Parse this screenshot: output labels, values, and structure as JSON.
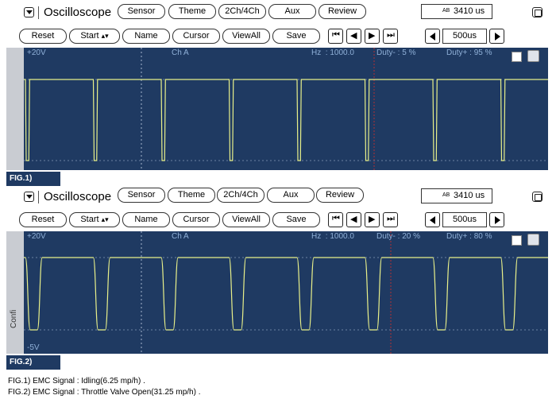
{
  "panels": [
    {
      "title": "Oscilloscope",
      "menu": [
        "Sensor",
        "Theme",
        "2Ch/4Ch",
        "Aux",
        "Review"
      ],
      "time_readout": "3410 us",
      "ab_glyph": "AB",
      "toolbar2": [
        "Reset",
        "Start",
        "Name",
        "Cursor",
        "ViewAll",
        "Save"
      ],
      "timebase": "500us",
      "scale_top": "+20V",
      "scale_bottom": "",
      "channel": "Ch A",
      "hz": "Hz  : 1000.0",
      "duty_minus": "Duty- : 5 %",
      "duty_plus": "Duty+ : 95 %",
      "side_text": "",
      "fig_tag": "FIG.1)",
      "duty_low_fraction": 0.05
    },
    {
      "title": "Oscilloscope",
      "menu": [
        "Sensor",
        "Theme",
        "2Ch/4Ch",
        "Aux",
        "Review"
      ],
      "time_readout": "3410 us",
      "ab_glyph": "AB",
      "toolbar2": [
        "Reset",
        "Start",
        "Name",
        "Cursor",
        "ViewAll",
        "Save"
      ],
      "timebase": "500us",
      "scale_top": "+20V",
      "scale_bottom": "-5V",
      "channel": "Ch A",
      "hz": "Hz  : 1000.0",
      "duty_minus": "Duty- : 20 %",
      "duty_plus": "Duty+ : 80 %",
      "side_text": "Confi",
      "fig_tag": "FIG.2)",
      "duty_low_fraction": 0.2
    }
  ],
  "captions": [
    "FIG.1) EMC Signal : Idling(6.25 mp/h) .",
    "FIG.2) EMC Signal : Throttle Valve Open(31.25 mp/h) ."
  ],
  "colors": {
    "screen": "#1f3a62",
    "trace": "#e8f08a",
    "cursor": "#c03030",
    "grid": "#b8c8e0"
  }
}
